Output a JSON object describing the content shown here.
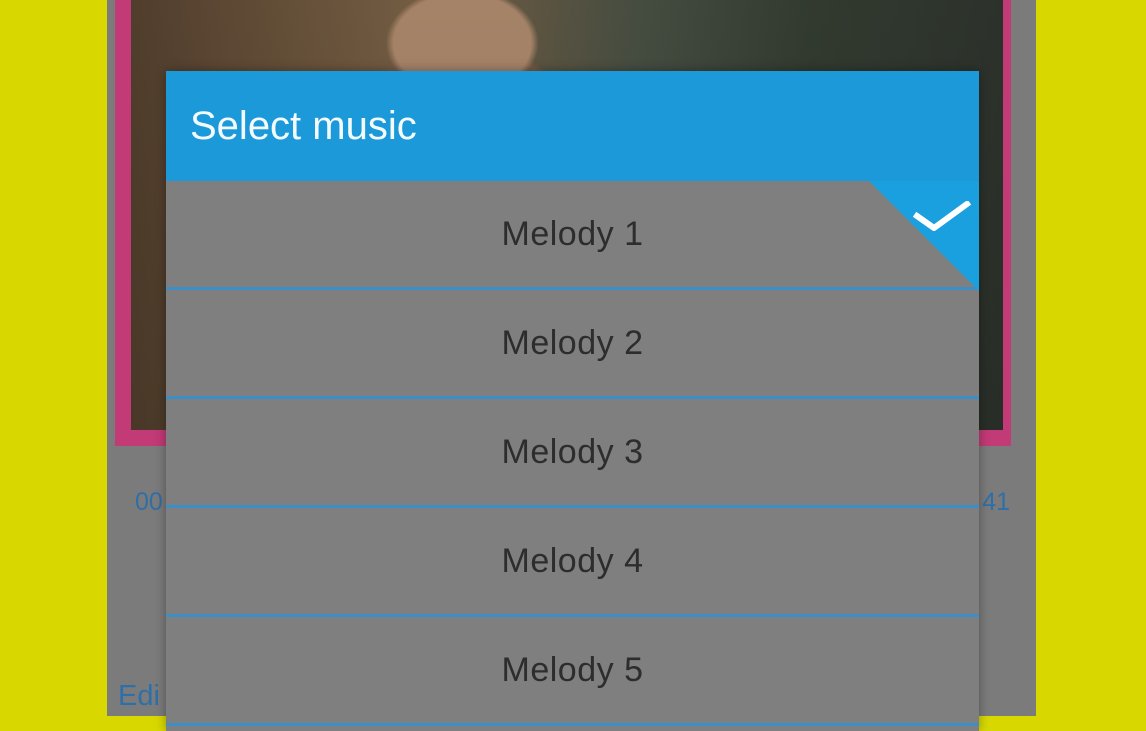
{
  "background_color": "#d8d800",
  "photo": {
    "description_icon": "woman-photo"
  },
  "timeline": {
    "start_time_partial": "00",
    "end_time_partial": "41"
  },
  "footer": {
    "edit_partial": "Edi"
  },
  "dialog": {
    "title": "Select music",
    "selected_index": 0,
    "items": [
      {
        "label": "Melody 1"
      },
      {
        "label": "Melody 2"
      },
      {
        "label": "Melody 3"
      },
      {
        "label": "Melody 4"
      },
      {
        "label": "Melody 5"
      }
    ],
    "colors": {
      "header": "#1b99d8",
      "item_divider": "#3b8ec6",
      "overlay": "#7f7f7f"
    },
    "icons": {
      "selected": "checkmark-icon"
    }
  }
}
